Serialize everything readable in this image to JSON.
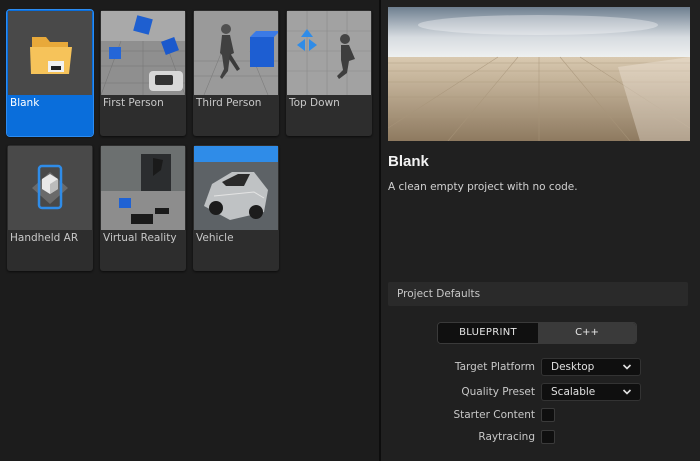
{
  "templates": [
    {
      "label": "Blank",
      "icon": "folder-icon",
      "selected": true
    },
    {
      "label": "First Person",
      "icon": "first-person-thumbnail"
    },
    {
      "label": "Third Person",
      "icon": "third-person-thumbnail"
    },
    {
      "label": "Top Down",
      "icon": "top-down-thumbnail"
    },
    {
      "label": "Handheld AR",
      "icon": "phone-ar-icon"
    },
    {
      "label": "Virtual Reality",
      "icon": "vr-thumbnail"
    },
    {
      "label": "Vehicle",
      "icon": "car-thumbnail"
    }
  ],
  "details": {
    "title": "Blank",
    "description": "A clean empty project with no code."
  },
  "defaults": {
    "section_title": "Project Defaults",
    "language_options": [
      "BLUEPRINT",
      "C++"
    ],
    "language_selected": "C++",
    "target_platform_label": "Target Platform",
    "target_platform_value": "Desktop",
    "quality_preset_label": "Quality Preset",
    "quality_preset_value": "Scalable",
    "starter_content_label": "Starter Content",
    "raytracing_label": "Raytracing"
  },
  "colors": {
    "accent": "#0a6edb",
    "panel": "#202020",
    "tile": "#2d2d2d"
  }
}
